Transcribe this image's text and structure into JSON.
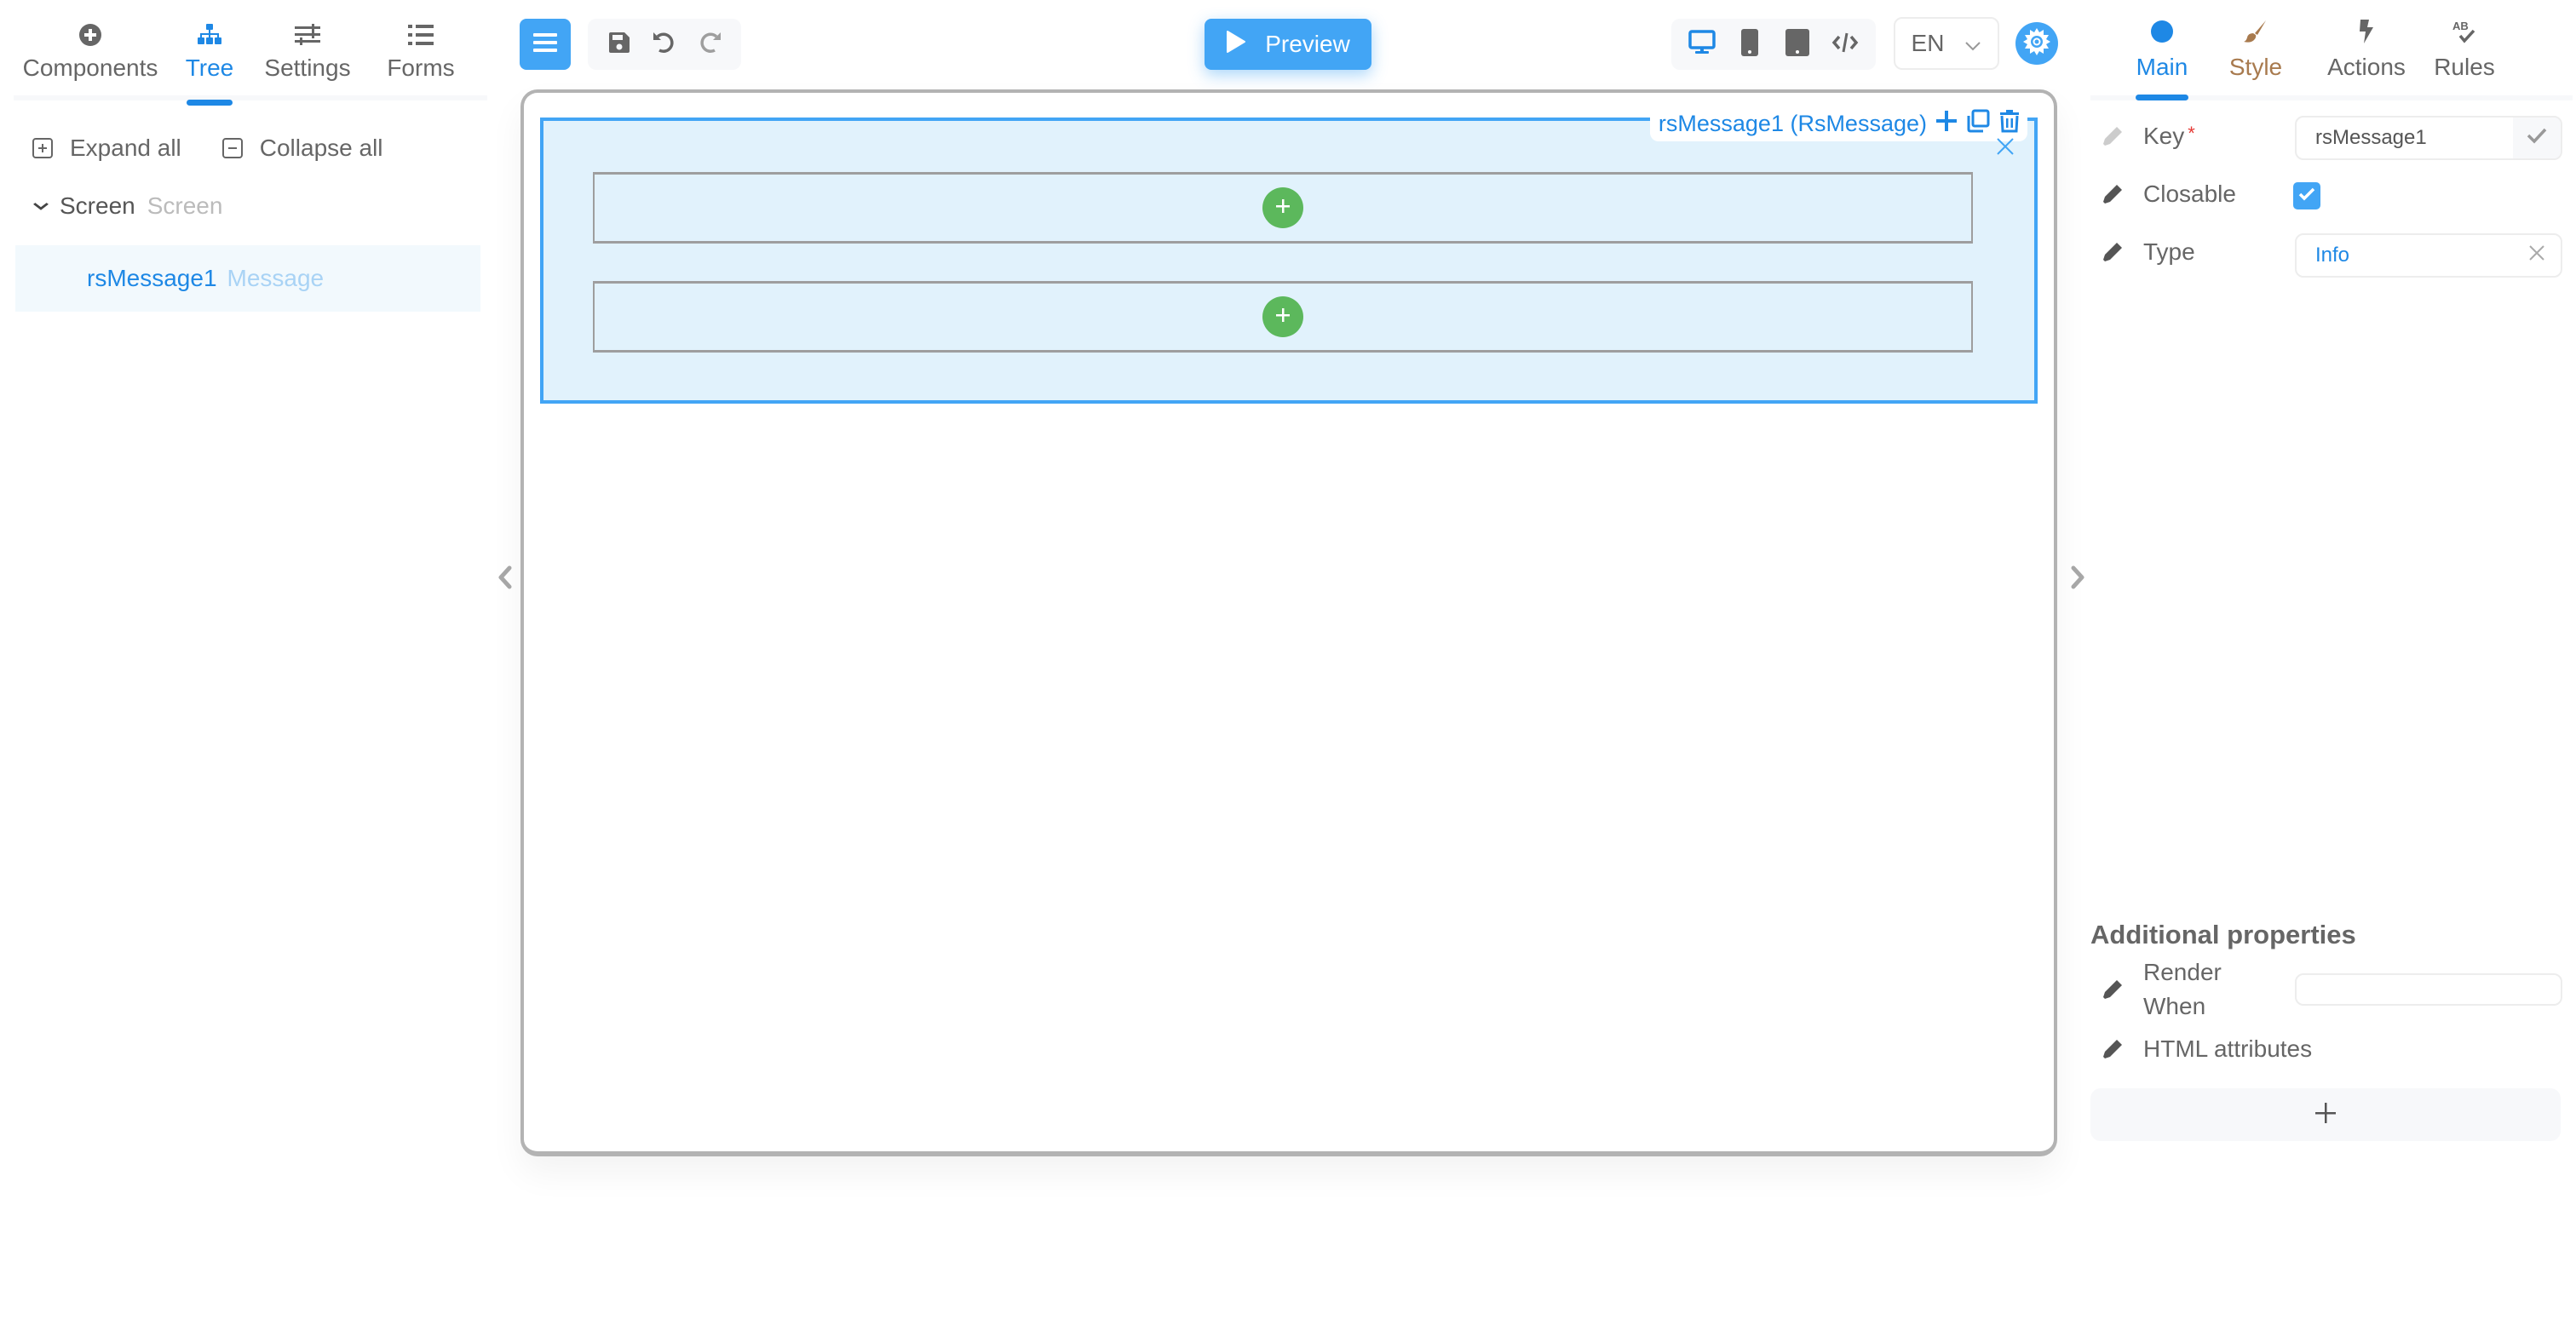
{
  "left_panel": {
    "tabs": [
      {
        "label": "Components",
        "icon": "plus-circle-icon"
      },
      {
        "label": "Tree",
        "icon": "sitemap-icon",
        "active": true
      },
      {
        "label": "Settings",
        "icon": "sliders-icon"
      },
      {
        "label": "Forms",
        "icon": "list-icon"
      }
    ],
    "expand_all": "Expand all",
    "collapse_all": "Collapse all",
    "tree": {
      "root": {
        "name": "Screen",
        "type": "Screen"
      },
      "children": [
        {
          "name": "rsMessage1",
          "type": "Message",
          "selected": true
        }
      ]
    }
  },
  "toolbar": {
    "menu_icon": "hamburger-icon",
    "save_icon": "floppy-disk-icon",
    "undo_icon": "undo-icon",
    "redo_icon": "redo-icon",
    "preview_label": "Preview",
    "devices": [
      "desktop-icon",
      "mobile-icon",
      "tablet-icon",
      "code-icon"
    ],
    "active_device": "desktop",
    "language": "EN",
    "settings_icon": "gear-icon"
  },
  "canvas": {
    "component_label": "rsMessage1 (RsMessage)",
    "component_actions": [
      "add-icon",
      "copy-icon",
      "trash-icon"
    ],
    "slots": 2
  },
  "right_panel": {
    "tabs": [
      {
        "label": "Main",
        "icon": "circle-icon",
        "active": true
      },
      {
        "label": "Style",
        "icon": "brush-icon"
      },
      {
        "label": "Actions",
        "icon": "bolt-icon"
      },
      {
        "label": "Rules",
        "icon": "spellcheck-icon"
      }
    ],
    "properties": {
      "key": {
        "label": "Key",
        "required_mark": "*",
        "value": "rsMessage1"
      },
      "closable": {
        "label": "Closable",
        "checked": true
      },
      "type": {
        "label": "Type",
        "value": "Info"
      }
    },
    "additional": {
      "title": "Additional properties",
      "render_when": {
        "label": "Render When",
        "value": ""
      },
      "html_attributes": {
        "label": "HTML attributes"
      },
      "add_label": "+"
    }
  },
  "colors": {
    "accent": "#1e88e5",
    "button": "#42a5f5",
    "selection_bg": "#e1f2fc",
    "add_green": "#5cb85c",
    "style_brown": "#a87a4e",
    "required_red": "#e53935"
  }
}
